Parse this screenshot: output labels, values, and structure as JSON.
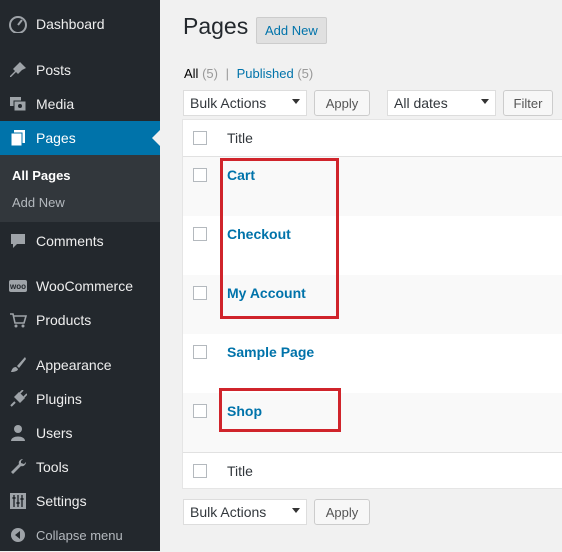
{
  "sidebar": {
    "items": [
      {
        "label": "Dashboard",
        "icon": "dashboard-icon"
      },
      {
        "label": "Posts",
        "icon": "pin-icon"
      },
      {
        "label": "Media",
        "icon": "media-icon"
      },
      {
        "label": "Pages",
        "icon": "pages-icon",
        "active": true
      },
      {
        "label": "Comments",
        "icon": "comment-icon"
      },
      {
        "label": "WooCommerce",
        "icon": "woocommerce-icon"
      },
      {
        "label": "Products",
        "icon": "cart-icon"
      },
      {
        "label": "Appearance",
        "icon": "brush-icon"
      },
      {
        "label": "Plugins",
        "icon": "plug-icon"
      },
      {
        "label": "Users",
        "icon": "user-icon"
      },
      {
        "label": "Tools",
        "icon": "wrench-icon"
      },
      {
        "label": "Settings",
        "icon": "settings-sliders-icon"
      }
    ],
    "submenu": {
      "all_pages": "All Pages",
      "add_new": "Add New"
    },
    "woo_badge": "woo",
    "collapse": "Collapse menu"
  },
  "main": {
    "title": "Pages",
    "add_new": "Add New",
    "filters": {
      "all": "All",
      "all_count": "(5)",
      "sep": "|",
      "published": "Published",
      "published_count": "(5)"
    },
    "bulk_actions": "Bulk Actions",
    "apply": "Apply",
    "all_dates": "All dates",
    "filter": "Filter",
    "table": {
      "header": "Title",
      "footer": "Title",
      "rows": [
        "Cart",
        "Checkout",
        "My Account",
        "Sample Page",
        "Shop"
      ]
    }
  },
  "colors": {
    "sidebar_bg": "#23282d",
    "active": "#0073aa",
    "link": "#0073aa",
    "highlight": "#d0242b"
  }
}
